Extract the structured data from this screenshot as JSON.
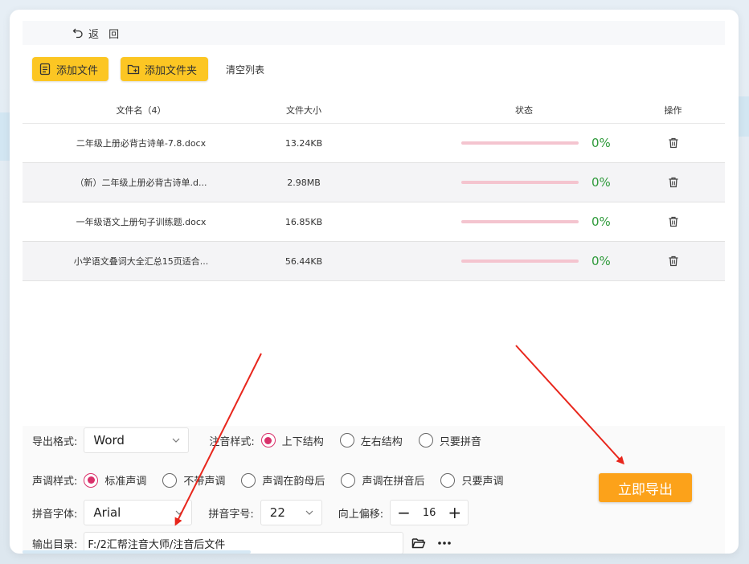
{
  "header": {
    "back_label": "返 回"
  },
  "toolbar": {
    "add_file": "添加文件",
    "add_folder": "添加文件夹",
    "clear_list": "清空列表"
  },
  "table": {
    "headers": {
      "name": "文件名（4）",
      "size": "文件大小",
      "status": "状态",
      "op": "操作"
    },
    "rows": [
      {
        "name": "二年级上册必背古诗单-7.8.docx",
        "size": "13.24KB",
        "percent": "0%",
        "progress": 0
      },
      {
        "name": "（新）二年级上册必背古诗单.d...",
        "size": "2.98MB",
        "percent": "0%",
        "progress": 0
      },
      {
        "name": "一年级语文上册句子训练题.docx",
        "size": "16.85KB",
        "percent": "0%",
        "progress": 0
      },
      {
        "name": "小学语文叠词大全汇总15页适合...",
        "size": "56.44KB",
        "percent": "0%",
        "progress": 0
      }
    ]
  },
  "settings": {
    "export_format_label": "导出格式:",
    "export_format_value": "Word",
    "annot_style_label": "注音样式:",
    "annot_options": [
      "上下结构",
      "左右结构",
      "只要拼音"
    ],
    "tone_style_label": "声调样式:",
    "tone_options": [
      "标准声调",
      "不带声调",
      "声调在韵母后",
      "声调在拼音后",
      "只要声调"
    ],
    "font_label": "拼音字体:",
    "font_value": "Arial",
    "size_label": "拼音字号:",
    "size_value": "22",
    "offset_label": "向上偏移:",
    "offset_value": "16",
    "output_label": "输出目录:",
    "output_value": "F:/2汇帮注音大师/注音后文件"
  },
  "export_button": "立即导出",
  "colors": {
    "accent_yellow": "#fcc623",
    "export_orange": "#fca21a",
    "radio_pink": "#d9306a",
    "percent_green": "#2e9a3a",
    "progress_track": "#f4c4cf",
    "arrow_red": "#e8261c"
  }
}
